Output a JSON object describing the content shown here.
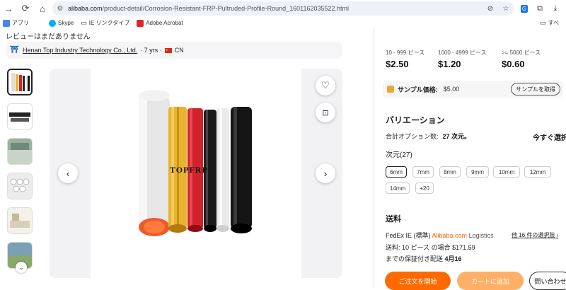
{
  "browser": {
    "url_domain": "alibaba.com",
    "url_path": "/product-detail/Corrosion-Resistant-FRP-Pultruded-Profile-Round_1601162035522.html",
    "bookmarks": [
      {
        "label": "アプリ",
        "icon": "grid-icon"
      },
      {
        "label": "Skype",
        "icon": "skype-icon"
      },
      {
        "label": "IE リンクタイプ",
        "icon": "folder-icon"
      },
      {
        "label": "Adobe Acrobat",
        "icon": "acrobat-icon"
      }
    ],
    "bookmarks_right": "すべ"
  },
  "page": {
    "review_note": "レビューはまだありません",
    "supplier": {
      "name": "Henan Top Industry Technology Co., Ltd.",
      "years": "· 7 yrs ·",
      "country": "CN"
    },
    "image_watermark": "TOPFRP"
  },
  "pricing": {
    "tiers": [
      {
        "range": "10 - 999 ピース",
        "price": "$2.50"
      },
      {
        "range": "1000 - 4999 ピース",
        "price": "$1.20"
      },
      {
        "range": ">= 5000 ピース",
        "price": "$0.60"
      }
    ],
    "sample_label": "サンプル価格:",
    "sample_price": "$5.00",
    "sample_button": "サンプルを取得"
  },
  "variations": {
    "title": "バリエーション",
    "option_count_label": "合計オプション数:",
    "option_count_value": "27 次元。",
    "select_now": "今すぐ選択",
    "dimension_label": "次元(27)",
    "chips": [
      "6mm",
      "7mm",
      "8mm",
      "9mm",
      "10mm",
      "12mm",
      "14mm",
      "+20"
    ],
    "selected": "6mm"
  },
  "shipping": {
    "title": "送料",
    "carrier": "FedEx IE (標準)",
    "alibaba": "Alibaba.com",
    "logistics": " Logistics",
    "other_link": "他 16 件の選択肢",
    "cost": "送料: 10 ピース の場合 $171.59",
    "guarantee_prefix": "までの保証付き配送",
    "guarantee_date": "4月16"
  },
  "actions": {
    "order": "ご注文を開始",
    "cart": "カートに追加",
    "inquiry": "問い合わせ"
  },
  "colors": {
    "accent": "#ff6a00",
    "accent_light": "#ffb066"
  }
}
